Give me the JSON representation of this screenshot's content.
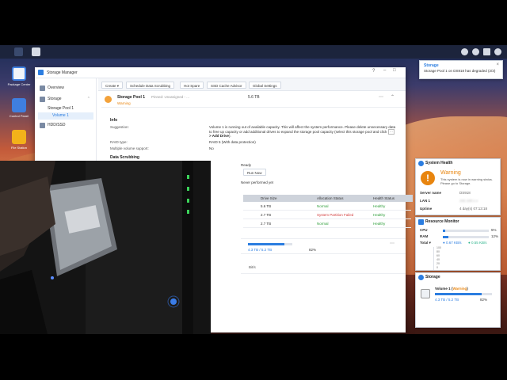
{
  "taskbar": {
    "left_icons": [
      "grid-icon",
      "apps-icon"
    ],
    "right_icons": [
      "chat-icon",
      "user-icon",
      "monitor-icon",
      "search-icon"
    ]
  },
  "desktop": {
    "icons": [
      {
        "label": "Package Center",
        "icon": "package-icon",
        "color": "#f1f4f9"
      },
      {
        "label": "Control Panel",
        "icon": "control-panel-icon",
        "color": "#3f7fe0"
      },
      {
        "label": "File Station",
        "icon": "folder-icon",
        "color": "#f3b21a"
      }
    ]
  },
  "notification": {
    "title": "Storage",
    "message": "Storage Pool 1 on DS918 has degraded (2/3)"
  },
  "window": {
    "title": "Storage Manager",
    "sidebar": {
      "items": [
        {
          "label": "Overview"
        },
        {
          "label": "Storage"
        },
        {
          "label": "Storage Pool 1"
        },
        {
          "label": "Volume 1"
        },
        {
          "label": "HDD/SSD"
        }
      ]
    },
    "toolbar": {
      "buttons": [
        "Create",
        "Schedule Data Scrubbing",
        "Hot Spare",
        "SSD Cache Advisor",
        "Global Settings"
      ]
    },
    "pool": {
      "name": "Storage Pool 1",
      "meta": "Pinned: Unassigned - ...",
      "size": "5.6 TB",
      "status": "Warning"
    },
    "info": {
      "heading": "Info",
      "suggestion_label": "Suggestion:",
      "suggestion_text": "Volume 1 is running out of available capacity. This will affect the system performance. Please delete unnecessary data to free up capacity or add additional drives to expand the storage pool capacity (select this storage pool and click",
      "suggestion_action": "Add Drive",
      "suggestion_end": ").",
      "raid_label": "RAID type:",
      "raid_value": "RAID 5 (With data protection)",
      "multi_label": "Multiple volume support:",
      "multi_value": "No",
      "scrub_heading": "Data Scrubbing",
      "scrub_status": "Ready",
      "scrub_button": "Run Now",
      "scrub_note": "Never performed yet"
    },
    "drives": {
      "headers": [
        "Drive Size",
        "Allocation Status",
        "Health Status"
      ],
      "rows": [
        [
          "5.6 TB",
          "Normal",
          "Healthy"
        ],
        [
          "2.7 TB",
          "System Partition Failed",
          "Healthy"
        ],
        [
          "2.7 TB",
          "Normal",
          "Healthy"
        ]
      ]
    },
    "volume": {
      "usage": "4.3 TB / 5.2 TB",
      "percent": "82%",
      "usage_fraction": 0.82,
      "speed": "Bit/s"
    }
  },
  "widgets": {
    "health": {
      "title": "System Health",
      "status": "Warning",
      "message": "This system is now in warning status. Please go to Storage.",
      "server_label": "Server name",
      "server_value": "DS918",
      "lan_label": "LAN 1",
      "lan_value": "192.168.x.x",
      "uptime_label": "Uptime",
      "uptime_value": "4 day(s) 07:13:18"
    },
    "resource": {
      "title": "Resource Monitor",
      "cpu_label": "CPU",
      "cpu_value": "5%",
      "cpu_fraction": 0.05,
      "ram_label": "RAM",
      "ram_value": "12%",
      "ram_fraction": 0.12,
      "total_label": "Total",
      "up_speed": "0.67 KB/s",
      "down_speed": "0.55 KB/s",
      "y_ticks": [
        "100",
        "80",
        "60",
        "40",
        "20",
        "0"
      ]
    },
    "storage": {
      "title": "Storage",
      "volume_label": "Volume 1",
      "warning": "Warning",
      "usage": "4.3 TB / 5.2 TB",
      "percent": "82%",
      "usage_fraction": 0.82
    }
  },
  "colors": {
    "accent": "#2b7de0",
    "warning": "#e8850f",
    "healthy": "#2e9e3a",
    "error": "#d33c3c"
  }
}
